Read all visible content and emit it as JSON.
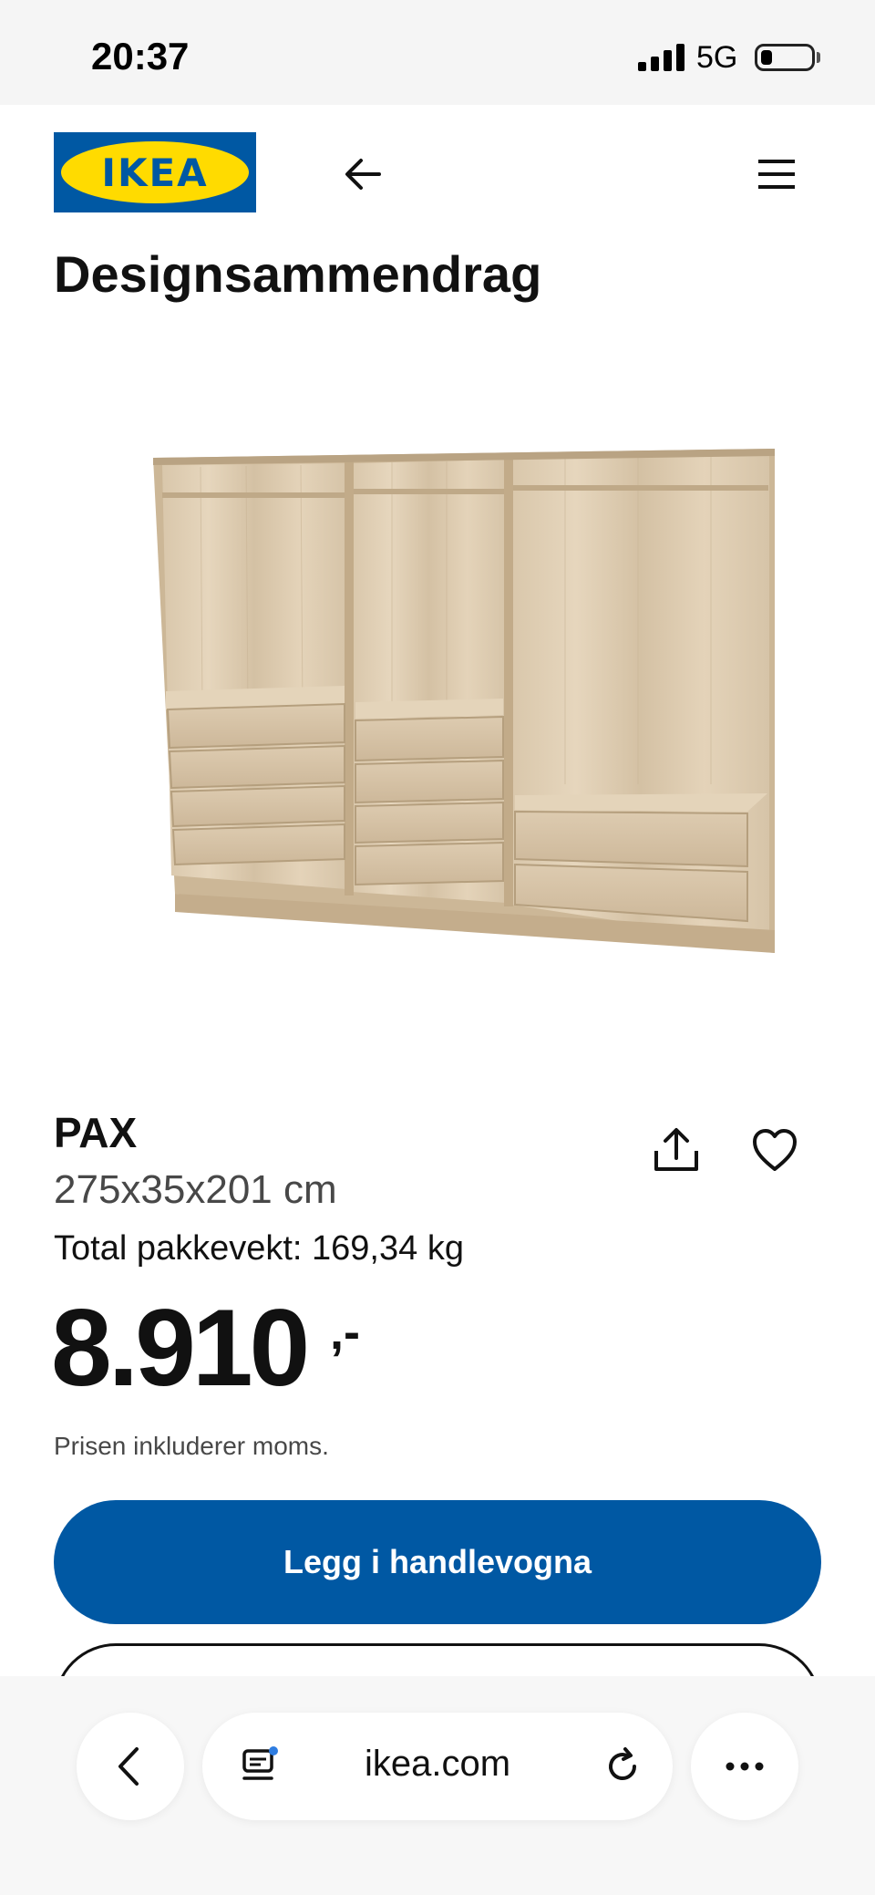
{
  "status_bar": {
    "time": "20:37",
    "network": "5G"
  },
  "header": {
    "logo_text": "IKEA"
  },
  "page": {
    "title": "Designsammendrag"
  },
  "product": {
    "name": "PAX",
    "dimensions": "275x35x201 cm",
    "weight": "Total pakkevekt: 169,34 kg",
    "price": "8.910",
    "price_suffix": ",-",
    "vat_note": "Prisen inkluderer moms."
  },
  "actions": {
    "add_to_cart_label": "Legg i handlevogna"
  },
  "browser": {
    "url": "ikea.com"
  },
  "colors": {
    "brand_blue": "#0058a3",
    "brand_yellow": "#ffdb00",
    "wood": "#d8c5a8"
  },
  "icons": [
    "back-arrow-icon",
    "menu-icon",
    "share-icon",
    "heart-icon",
    "tabs-icon",
    "reload-icon",
    "more-icon",
    "chevron-left-icon"
  ]
}
